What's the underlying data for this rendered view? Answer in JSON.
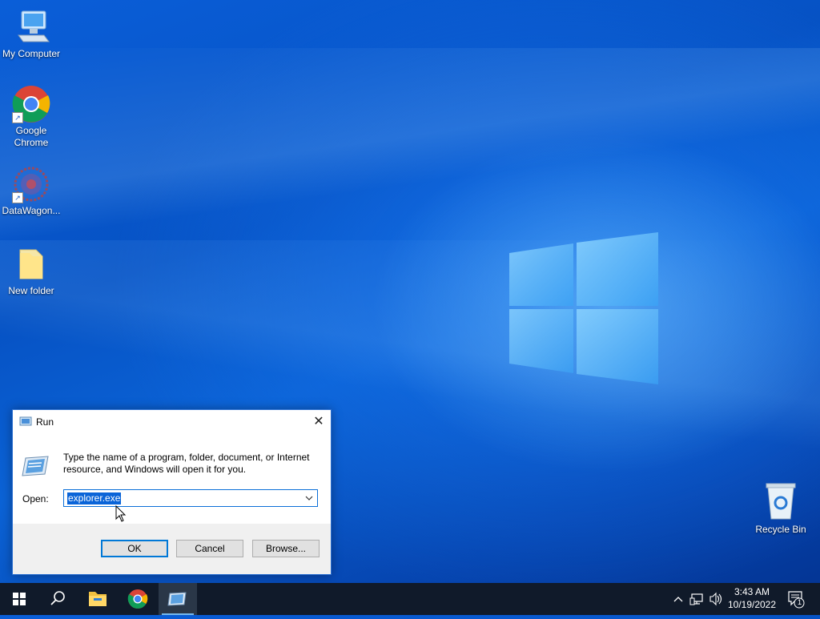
{
  "desktop": {
    "icons": [
      {
        "label": "My Computer"
      },
      {
        "label": "Google Chrome"
      },
      {
        "label": "DataWagon..."
      },
      {
        "label": "New folder"
      }
    ],
    "recycle_bin": {
      "label": "Recycle Bin"
    }
  },
  "run_dialog": {
    "title": "Run",
    "close_glyph": "✕",
    "description": "Type the name of a program, folder, document, or Internet resource, and Windows will open it for you.",
    "open_label": "Open:",
    "open_value": "explorer.exe",
    "ok_label": "OK",
    "cancel_label": "Cancel",
    "browse_label": "Browse..."
  },
  "taskbar": {
    "clock_time": "3:43 AM",
    "clock_date": "10/19/2022",
    "notification_count": "1",
    "accent": "#76b9ed",
    "background": "#101a2a"
  }
}
